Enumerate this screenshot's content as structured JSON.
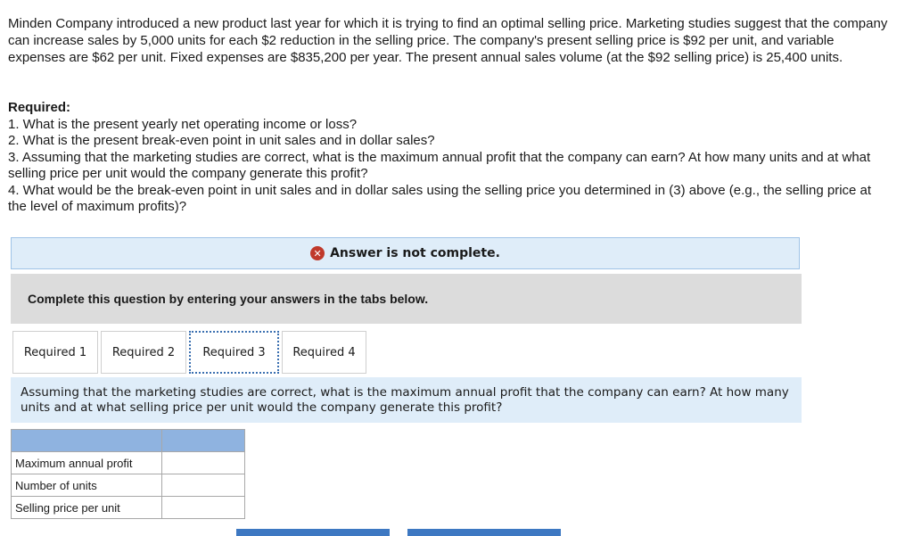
{
  "problem": {
    "intro": "Minden Company introduced a new product last year for which it is trying to find an optimal selling price. Marketing studies suggest that the company can increase sales by 5,000 units for each $2 reduction in the selling price. The company's present selling price is $92 per unit, and variable expenses are $62 per unit. Fixed expenses are $835,200 per year. The present annual sales volume (at the $92 selling price) is 25,400 units.",
    "required_heading": "Required:",
    "requirements": [
      "1. What is the present yearly net operating income or loss?",
      "2. What is the present break-even point in unit sales and in dollar sales?",
      "3. Assuming that the marketing studies are correct, what is the maximum annual profit that the company can earn? At how many units and at what selling price per unit would the company generate this profit?",
      "4. What would be the break-even point in unit sales and in dollar sales using the selling price you determined in (3) above (e.g., the selling price at the level of maximum profits)?"
    ]
  },
  "status": {
    "icon": "x-circle-icon",
    "text": "Answer is not complete."
  },
  "instruction": "Complete this question by entering your answers in the tabs below.",
  "tabs": [
    {
      "label": "Required 1"
    },
    {
      "label": "Required 2"
    },
    {
      "label": "Required 3",
      "active": true
    },
    {
      "label": "Required 4"
    }
  ],
  "question": "Assuming that the marketing studies are correct, what is the maximum annual profit that the company can earn? At how many units and at what selling price per unit would the company generate this profit?",
  "answer_table": {
    "rows": [
      {
        "label": "Maximum annual profit",
        "value": ""
      },
      {
        "label": "Number of units",
        "value": ""
      },
      {
        "label": "Selling price per unit",
        "value": ""
      }
    ]
  },
  "colors": {
    "accent": "#3d78c2",
    "status_bg": "#dfedf9",
    "error": "#c0392b",
    "header_cell": "#8fb3e0"
  }
}
